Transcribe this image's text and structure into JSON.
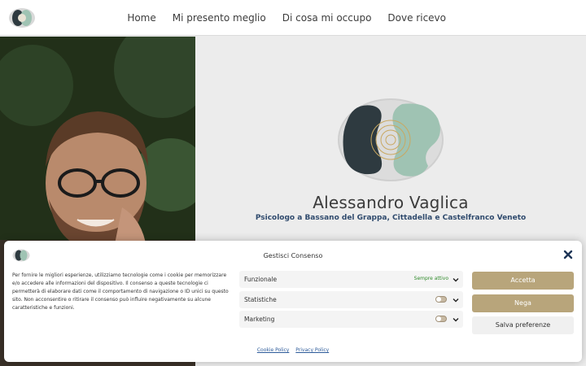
{
  "header": {
    "nav": [
      "Home",
      "Mi presento meglio",
      "Di cosa mi occupo",
      "Dove ricevo"
    ]
  },
  "hero": {
    "name": "Alessandro Vaglica",
    "subtitle": "Psicologo a Bassano del Grappa, Cittadella e Castelfranco Veneto"
  },
  "consent": {
    "title": "Gestisci Consenso",
    "text": "Per fornire le migliori esperienze, utilizziamo tecnologie come i cookie per memorizzare e/o accedere alle informazioni del dispositivo. Il consenso a queste tecnologie ci permetterà di elaborare dati come il comportamento di navigazione o ID unici su questo sito. Non acconsentire o ritirare il consenso può influire negativamente su alcune caratteristiche e funzioni.",
    "preferences": [
      {
        "label": "Funzionale",
        "status": "Sempre attivo"
      },
      {
        "label": "Statistiche"
      },
      {
        "label": "Marketing"
      }
    ],
    "buttons": {
      "accept": "Accetta",
      "deny": "Nega",
      "save": "Salva preferenze"
    },
    "links": {
      "cookie_policy": "Cookie Policy",
      "privacy_policy": "Privacy Policy"
    }
  },
  "colors": {
    "accent": "#b8a57b",
    "subtitle": "#2f4a6d",
    "logo_dark": "#2e3a40",
    "logo_mint": "#9fc3b3"
  },
  "icons": [
    "site-logo-icon",
    "close-icon",
    "chevron-down-icon"
  ]
}
